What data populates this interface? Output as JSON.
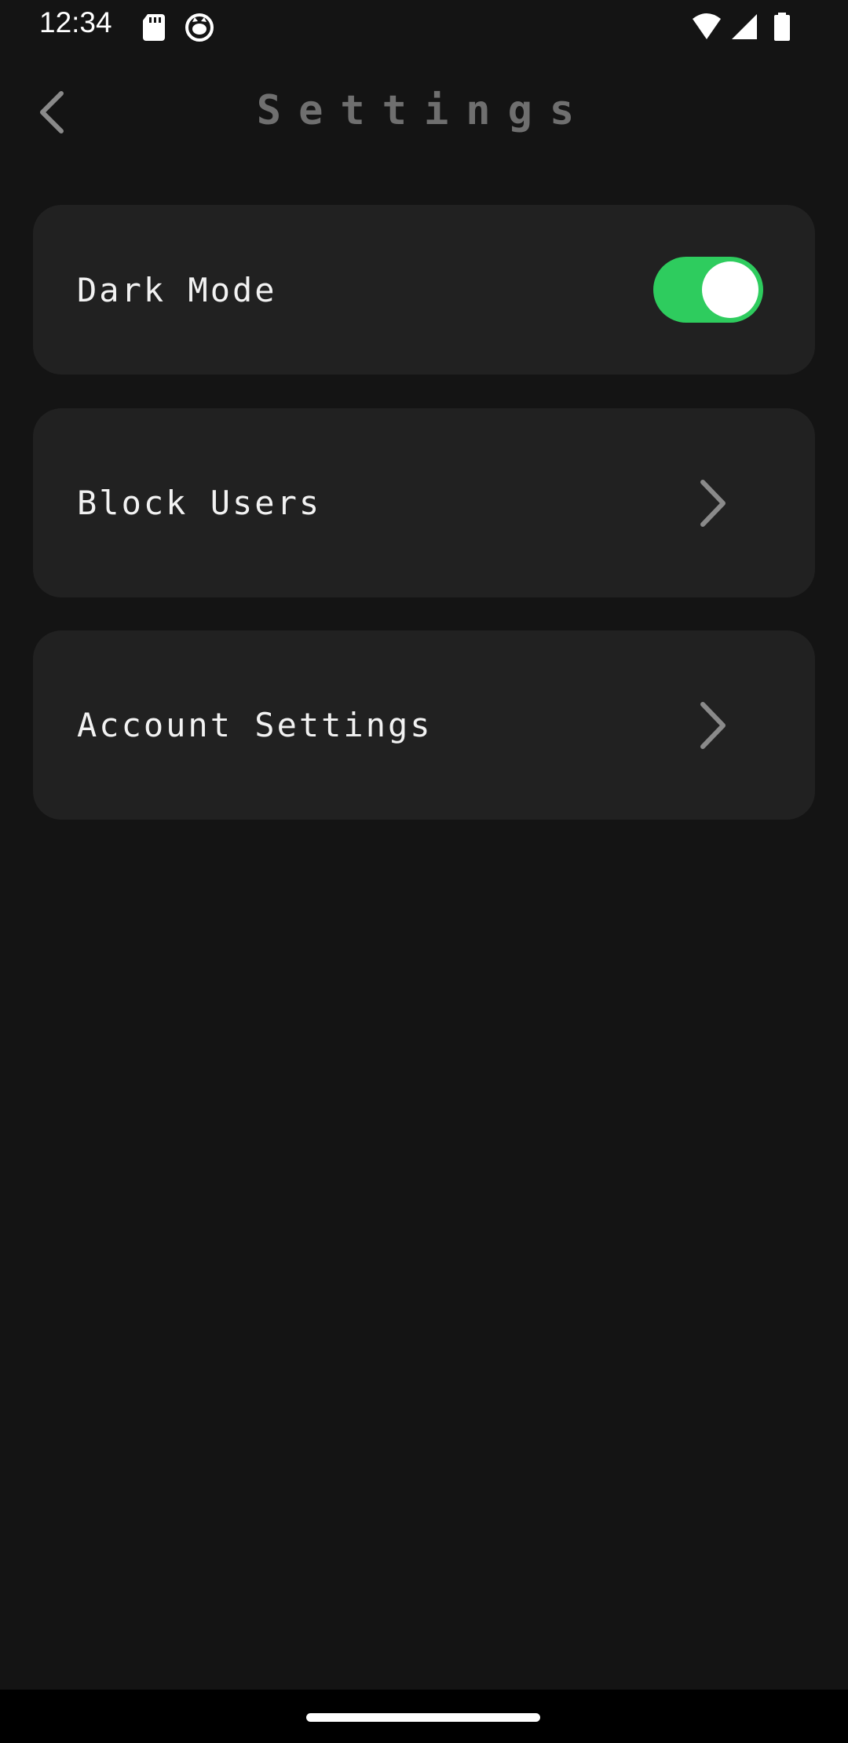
{
  "status_bar": {
    "time": "12:34",
    "icons": [
      "sd-card-icon",
      "cat-notification-icon",
      "wifi-icon",
      "cellular-signal-icon",
      "battery-icon"
    ]
  },
  "header": {
    "title": "Settings",
    "back_icon": "chevron-left-icon"
  },
  "settings": {
    "dark_mode": {
      "label": "Dark Mode",
      "enabled": true
    },
    "block_users": {
      "label": "Block Users",
      "icon": "chevron-right-icon"
    },
    "account_settings": {
      "label": "Account Settings",
      "icon": "chevron-right-icon"
    }
  },
  "colors": {
    "background": "#141414",
    "card": "#212121",
    "accent": "#2ecc5e",
    "title": "#6f6f6f",
    "chevron": "#8a8a8a"
  }
}
